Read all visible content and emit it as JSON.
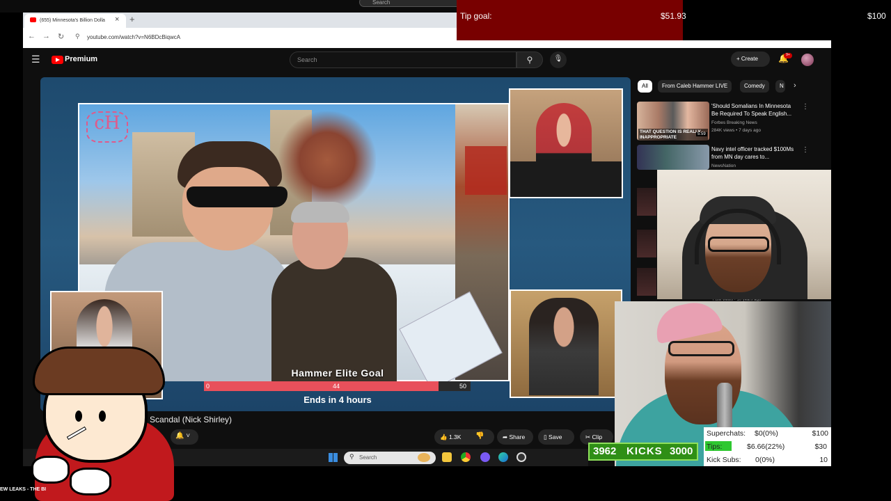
{
  "browser": {
    "omnibox_text": "Search",
    "tab_title": "(655) Minnesota's Billion Dolla",
    "url": "youtube.com/watch?v=N6BDcBiqwcA"
  },
  "tip_goal": {
    "label": "Tip goal:",
    "current": "$51.93",
    "max": "$100",
    "fill_color": "#780000"
  },
  "youtube": {
    "brand": "Premium",
    "search_placeholder": "Search",
    "create_label": "+ Create",
    "notif_count": "9+",
    "chips": [
      "All",
      "From Caleb Hammer LIVE",
      "Comedy",
      "N"
    ],
    "video_title": "d Scandal (Nick Shirley)",
    "likes": "1.3K",
    "share_label": "Share",
    "save_label": "Save",
    "clip_label": "Clip"
  },
  "goal_overlay": {
    "title": "Hammer Elite Goal",
    "start": "0",
    "current": "44",
    "end": "50",
    "fraction": 0.88,
    "ends_text": "Ends in 4 hours",
    "fill_color": "#e8505b"
  },
  "recommendations": [
    {
      "title": "'Should Somalians In Minnesota Be Required To Speak English...",
      "channel": "Forbes Breaking News",
      "views": "284K views • 7 days ago",
      "thumb_caption": "THAT QUESTION IS REALLY INAPPROPRIATE",
      "duration": "5:59"
    },
    {
      "title": "Navy intel officer tracked $100Ms from MN day cares to...",
      "channel": "NewsNation"
    }
  ],
  "views_bottom": "7.6M views • 10 years ago",
  "kicks": {
    "current": "3962",
    "label": "KICKS",
    "goal": "3000",
    "color": "#2f8f16"
  },
  "donations": [
    {
      "label": "Superchats:",
      "value": "$0(0%)",
      "max": "$100"
    },
    {
      "label": "Tips:",
      "value": "$6.66(22%)",
      "max": "$30"
    },
    {
      "label": "Kick Subs:",
      "value": "0(0%)",
      "max": "10"
    }
  ],
  "taskbar": {
    "search_placeholder": "Search"
  },
  "ticker": "EW LEAKS - THE BI"
}
